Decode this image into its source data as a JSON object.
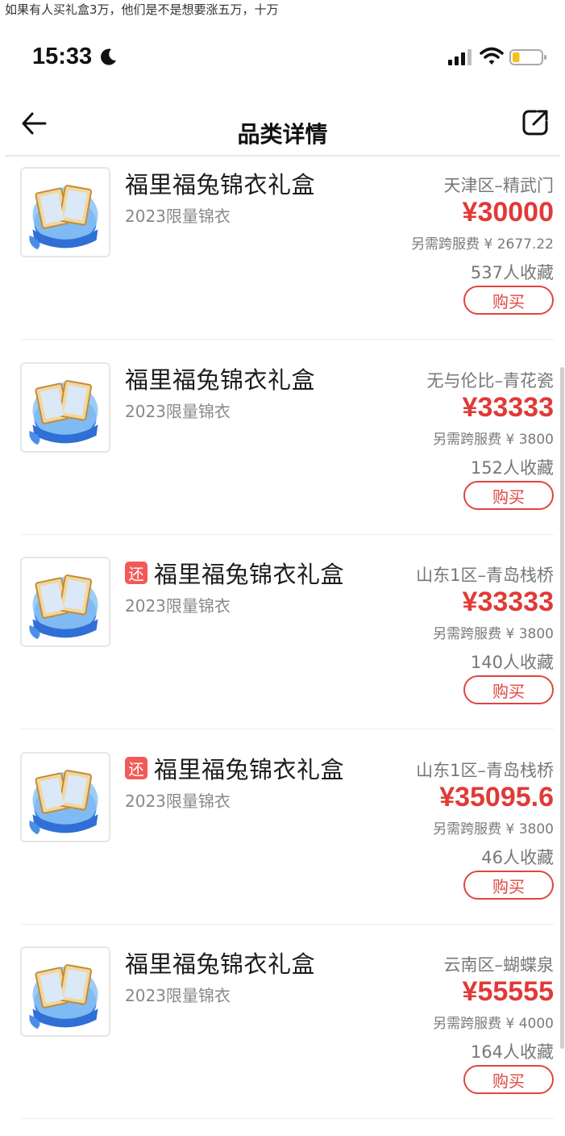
{
  "caption": "如果有人买礼盒3万，他们是不是想要涨五万，十万",
  "status": {
    "time": "15:33",
    "battery_level": 0.25
  },
  "nav": {
    "title": "品类详情",
    "back_icon": "back-arrow-icon",
    "share_icon": "share-icon"
  },
  "items": [
    {
      "name": "福里福兔锦衣礼盒",
      "subtitle": "2023限量锦衣",
      "badge": "",
      "server": "天津区–精武门",
      "price": "¥30000",
      "fee": "另需跨服费 ¥ 2677.22",
      "favs": "537人收藏",
      "buy": "购买"
    },
    {
      "name": "福里福兔锦衣礼盒",
      "subtitle": "2023限量锦衣",
      "badge": "",
      "server": "无与伦比–青花瓷",
      "price": "¥33333",
      "fee": "另需跨服费 ¥ 3800",
      "favs": "152人收藏",
      "buy": "购买"
    },
    {
      "name": "福里福兔锦衣礼盒",
      "subtitle": "2023限量锦衣",
      "badge": "还",
      "server": "山东1区–青岛栈桥",
      "price": "¥33333",
      "fee": "另需跨服费 ¥ 3800",
      "favs": "140人收藏",
      "buy": "购买"
    },
    {
      "name": "福里福兔锦衣礼盒",
      "subtitle": "2023限量锦衣",
      "badge": "还",
      "server": "山东1区–青岛栈桥",
      "price": "¥35095.6",
      "fee": "另需跨服费 ¥ 3800",
      "favs": "46人收藏",
      "buy": "购买"
    },
    {
      "name": "福里福兔锦衣礼盒",
      "subtitle": "2023限量锦衣",
      "badge": "",
      "server": "云南区–蝴蝶泉",
      "price": "¥55555",
      "fee": "另需跨服费 ¥ 4000",
      "favs": "164人收藏",
      "buy": "购买"
    }
  ],
  "colors": {
    "price": "#e03a37",
    "badge": "#f25a57",
    "button": "#e0453f"
  }
}
